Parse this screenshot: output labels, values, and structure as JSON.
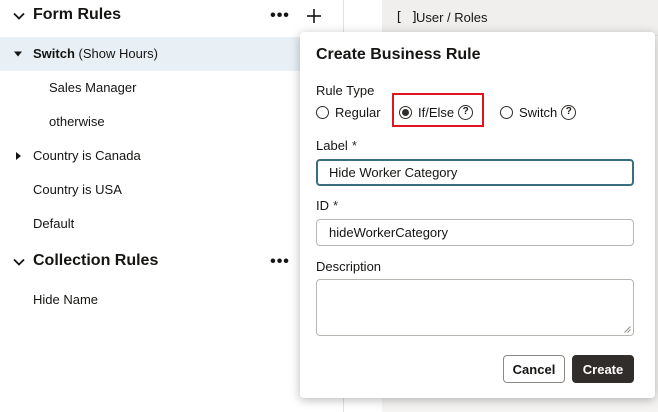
{
  "left_panel": {
    "form_rules": {
      "title": "Form Rules",
      "more_label": "•••",
      "items": [
        {
          "prefix": "Switch",
          "suffix": " (Show Hours)"
        },
        {
          "label": "Sales Manager"
        },
        {
          "label": "otherwise"
        },
        {
          "label": "Country is Canada"
        },
        {
          "label": "Country is USA"
        },
        {
          "label": "Default"
        }
      ]
    },
    "collection_rules": {
      "title": "Collection Rules",
      "more_label": "•••",
      "items": [
        {
          "label": "Hide Name"
        }
      ]
    }
  },
  "right_tab": {
    "icon_text": "[ ]",
    "label": "User / Roles"
  },
  "dialog": {
    "title": "Create Business Rule",
    "rule_type": {
      "label": "Rule Type",
      "options": [
        "Regular",
        "If/Else",
        "Switch"
      ],
      "selected": "If/Else"
    },
    "label_field": {
      "label": "Label",
      "required_mark": "*",
      "value": "Hide Worker Category"
    },
    "id_field": {
      "label": "ID",
      "required_mark": "*",
      "value": "hideWorkerCategory"
    },
    "description_field": {
      "label": "Description",
      "value": ""
    },
    "help_glyph": "?",
    "buttons": {
      "cancel": "Cancel",
      "create": "Create"
    }
  },
  "colors": {
    "selected_row_bg": "#e8f0f5",
    "focus_border": "#3a6d80",
    "highlight_border": "#e0141e",
    "primary_button_bg": "#312d2a"
  }
}
